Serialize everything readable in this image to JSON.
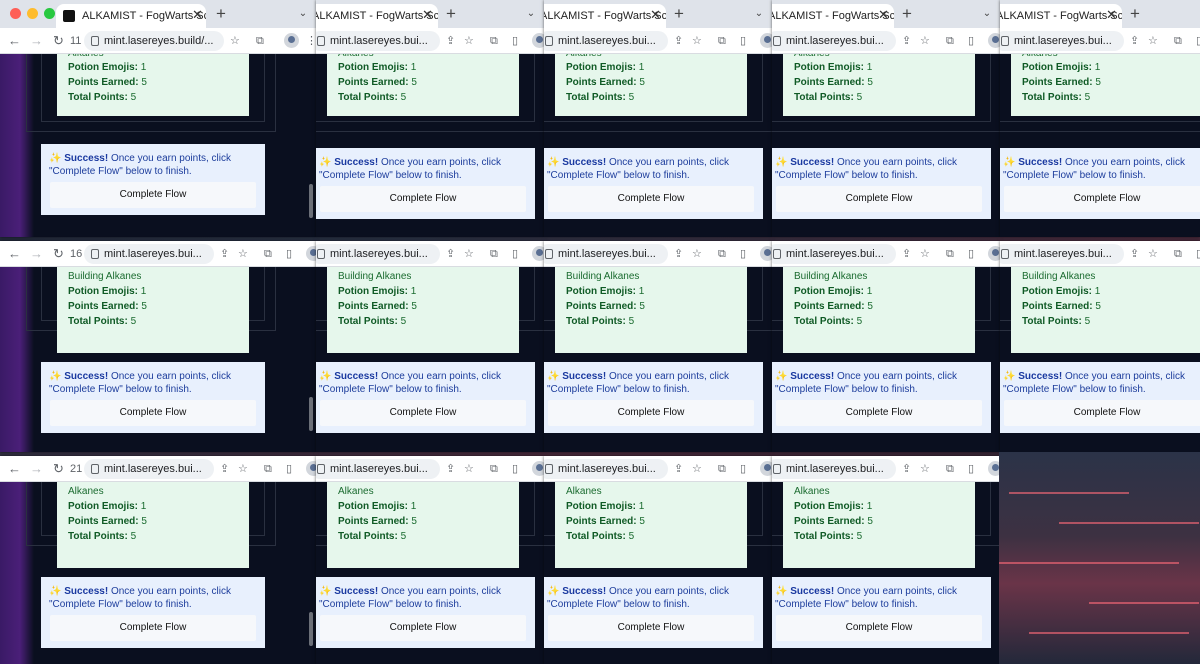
{
  "tab": {
    "title": "ALKAMIST - FogWarts School"
  },
  "url_full": "mint.lasereyes.build/...",
  "url_short": "mint.lasereyes.bui...",
  "tab_counts": [
    "11",
    "16",
    "21"
  ],
  "stats": {
    "partial": "Alkanes",
    "partial_long": "Building Alkanes",
    "potion_label": "Potion Emojis:",
    "potion_value": "1",
    "earned_label": "Points Earned:",
    "earned_value": "5",
    "total_label": "Total Points:",
    "total_value": "5"
  },
  "notice": {
    "icon": "✨",
    "strong": "Success!",
    "line1": "Once you earn points, click",
    "line2": "\"Complete Flow\" below to finish."
  },
  "button": {
    "label": "Complete Flow"
  },
  "colors": {
    "panel_green": "#e6f7ec",
    "panel_blue": "#e8f0fd",
    "purple": "#4a1f78"
  }
}
